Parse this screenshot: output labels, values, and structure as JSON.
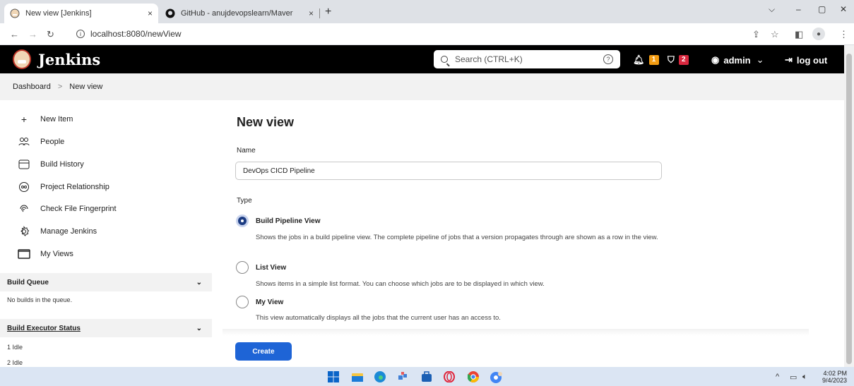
{
  "browser": {
    "tabs": [
      {
        "title": "New view [Jenkins]",
        "close": "×"
      },
      {
        "title": "GitHub - anujdevopslearn/Maver",
        "close": "×"
      }
    ],
    "new_tab": "+",
    "url": "localhost:8080/newView",
    "window_controls": {
      "min": "–",
      "restore": "▢",
      "close": "✕",
      "dropdown": "⌵"
    }
  },
  "header": {
    "app_name": "Jenkins",
    "search_placeholder": "Search (CTRL+K)",
    "help": "?",
    "notifications_count": "1",
    "security_count": "2",
    "user": "admin",
    "logout": "log out"
  },
  "breadcrumb": {
    "items": [
      "Dashboard",
      "New view"
    ],
    "sep": ">"
  },
  "sidebar": {
    "items": [
      {
        "label": "New Item",
        "icon": "plus-icon"
      },
      {
        "label": "People",
        "icon": "people-icon"
      },
      {
        "label": "Build History",
        "icon": "history-icon"
      },
      {
        "label": "Project Relationship",
        "icon": "relationship-icon"
      },
      {
        "label": "Check File Fingerprint",
        "icon": "fingerprint-icon"
      },
      {
        "label": "Manage Jenkins",
        "icon": "gear-icon"
      },
      {
        "label": "My Views",
        "icon": "window-icon"
      }
    ],
    "build_queue": {
      "title": "Build Queue",
      "body": "No builds in the queue."
    },
    "executor_status": {
      "title": "Build Executor Status",
      "rows": [
        "1  Idle",
        "2  Idle"
      ]
    }
  },
  "main": {
    "title": "New view",
    "name_label": "Name",
    "name_value": "DevOps CICD Pipeline",
    "type_label": "Type",
    "options": [
      {
        "label": "Build Pipeline View",
        "desc": "Shows the jobs in a build pipeline view. The complete pipeline of jobs that a version propagates through are shown as a row in the view.",
        "selected": true
      },
      {
        "label": "List View",
        "desc": "Shows items in a simple list format. You can choose which jobs are to be displayed in which view.",
        "selected": false
      },
      {
        "label": "My View",
        "desc": "This view automatically displays all the jobs that the current user has an access to.",
        "selected": false
      }
    ],
    "create_label": "Create"
  },
  "taskbar": {
    "time": "4:02 PM",
    "date": "9/4/2023"
  },
  "colors": {
    "accent": "#1e64d6",
    "header_bg": "#000000",
    "radio_selected": "#1c3c83"
  }
}
